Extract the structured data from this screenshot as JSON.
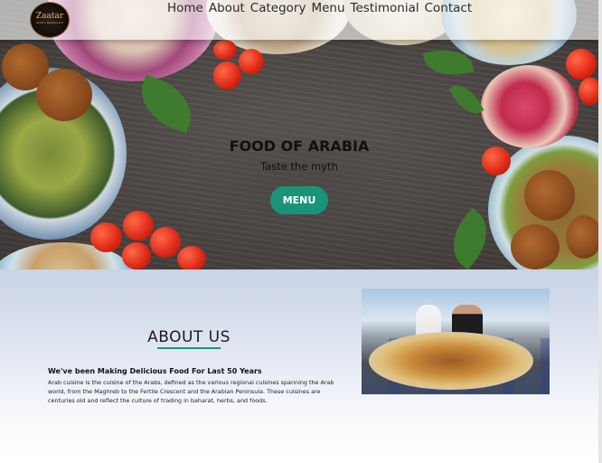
{
  "nav": {
    "logo": {
      "name": "Zaatar",
      "tagline": "Arabic Restaurant"
    },
    "links": [
      "Home",
      "About",
      "Category",
      "Menu",
      "Testimonial",
      "Contact"
    ]
  },
  "hero": {
    "title": "FOOD OF ARABIA",
    "subtitle": "Taste the myth",
    "button_label": "MENU"
  },
  "about": {
    "heading": "ABOUT US",
    "subheading": "We've been Making Delicious Food For Last 50 Years",
    "body": "Arab cuisine is the cuisine of the Arabs, defined as the various regional cuisines spanning the Arab world, from the Maghreb to the Fertile Crescent and the Arabian Peninsula. These cuisines are centuries old and reflect the culture of trading in baharat, herbs, and foods."
  },
  "colors": {
    "accent": "#1a9478",
    "about_background_top": "#c9d3e6"
  }
}
